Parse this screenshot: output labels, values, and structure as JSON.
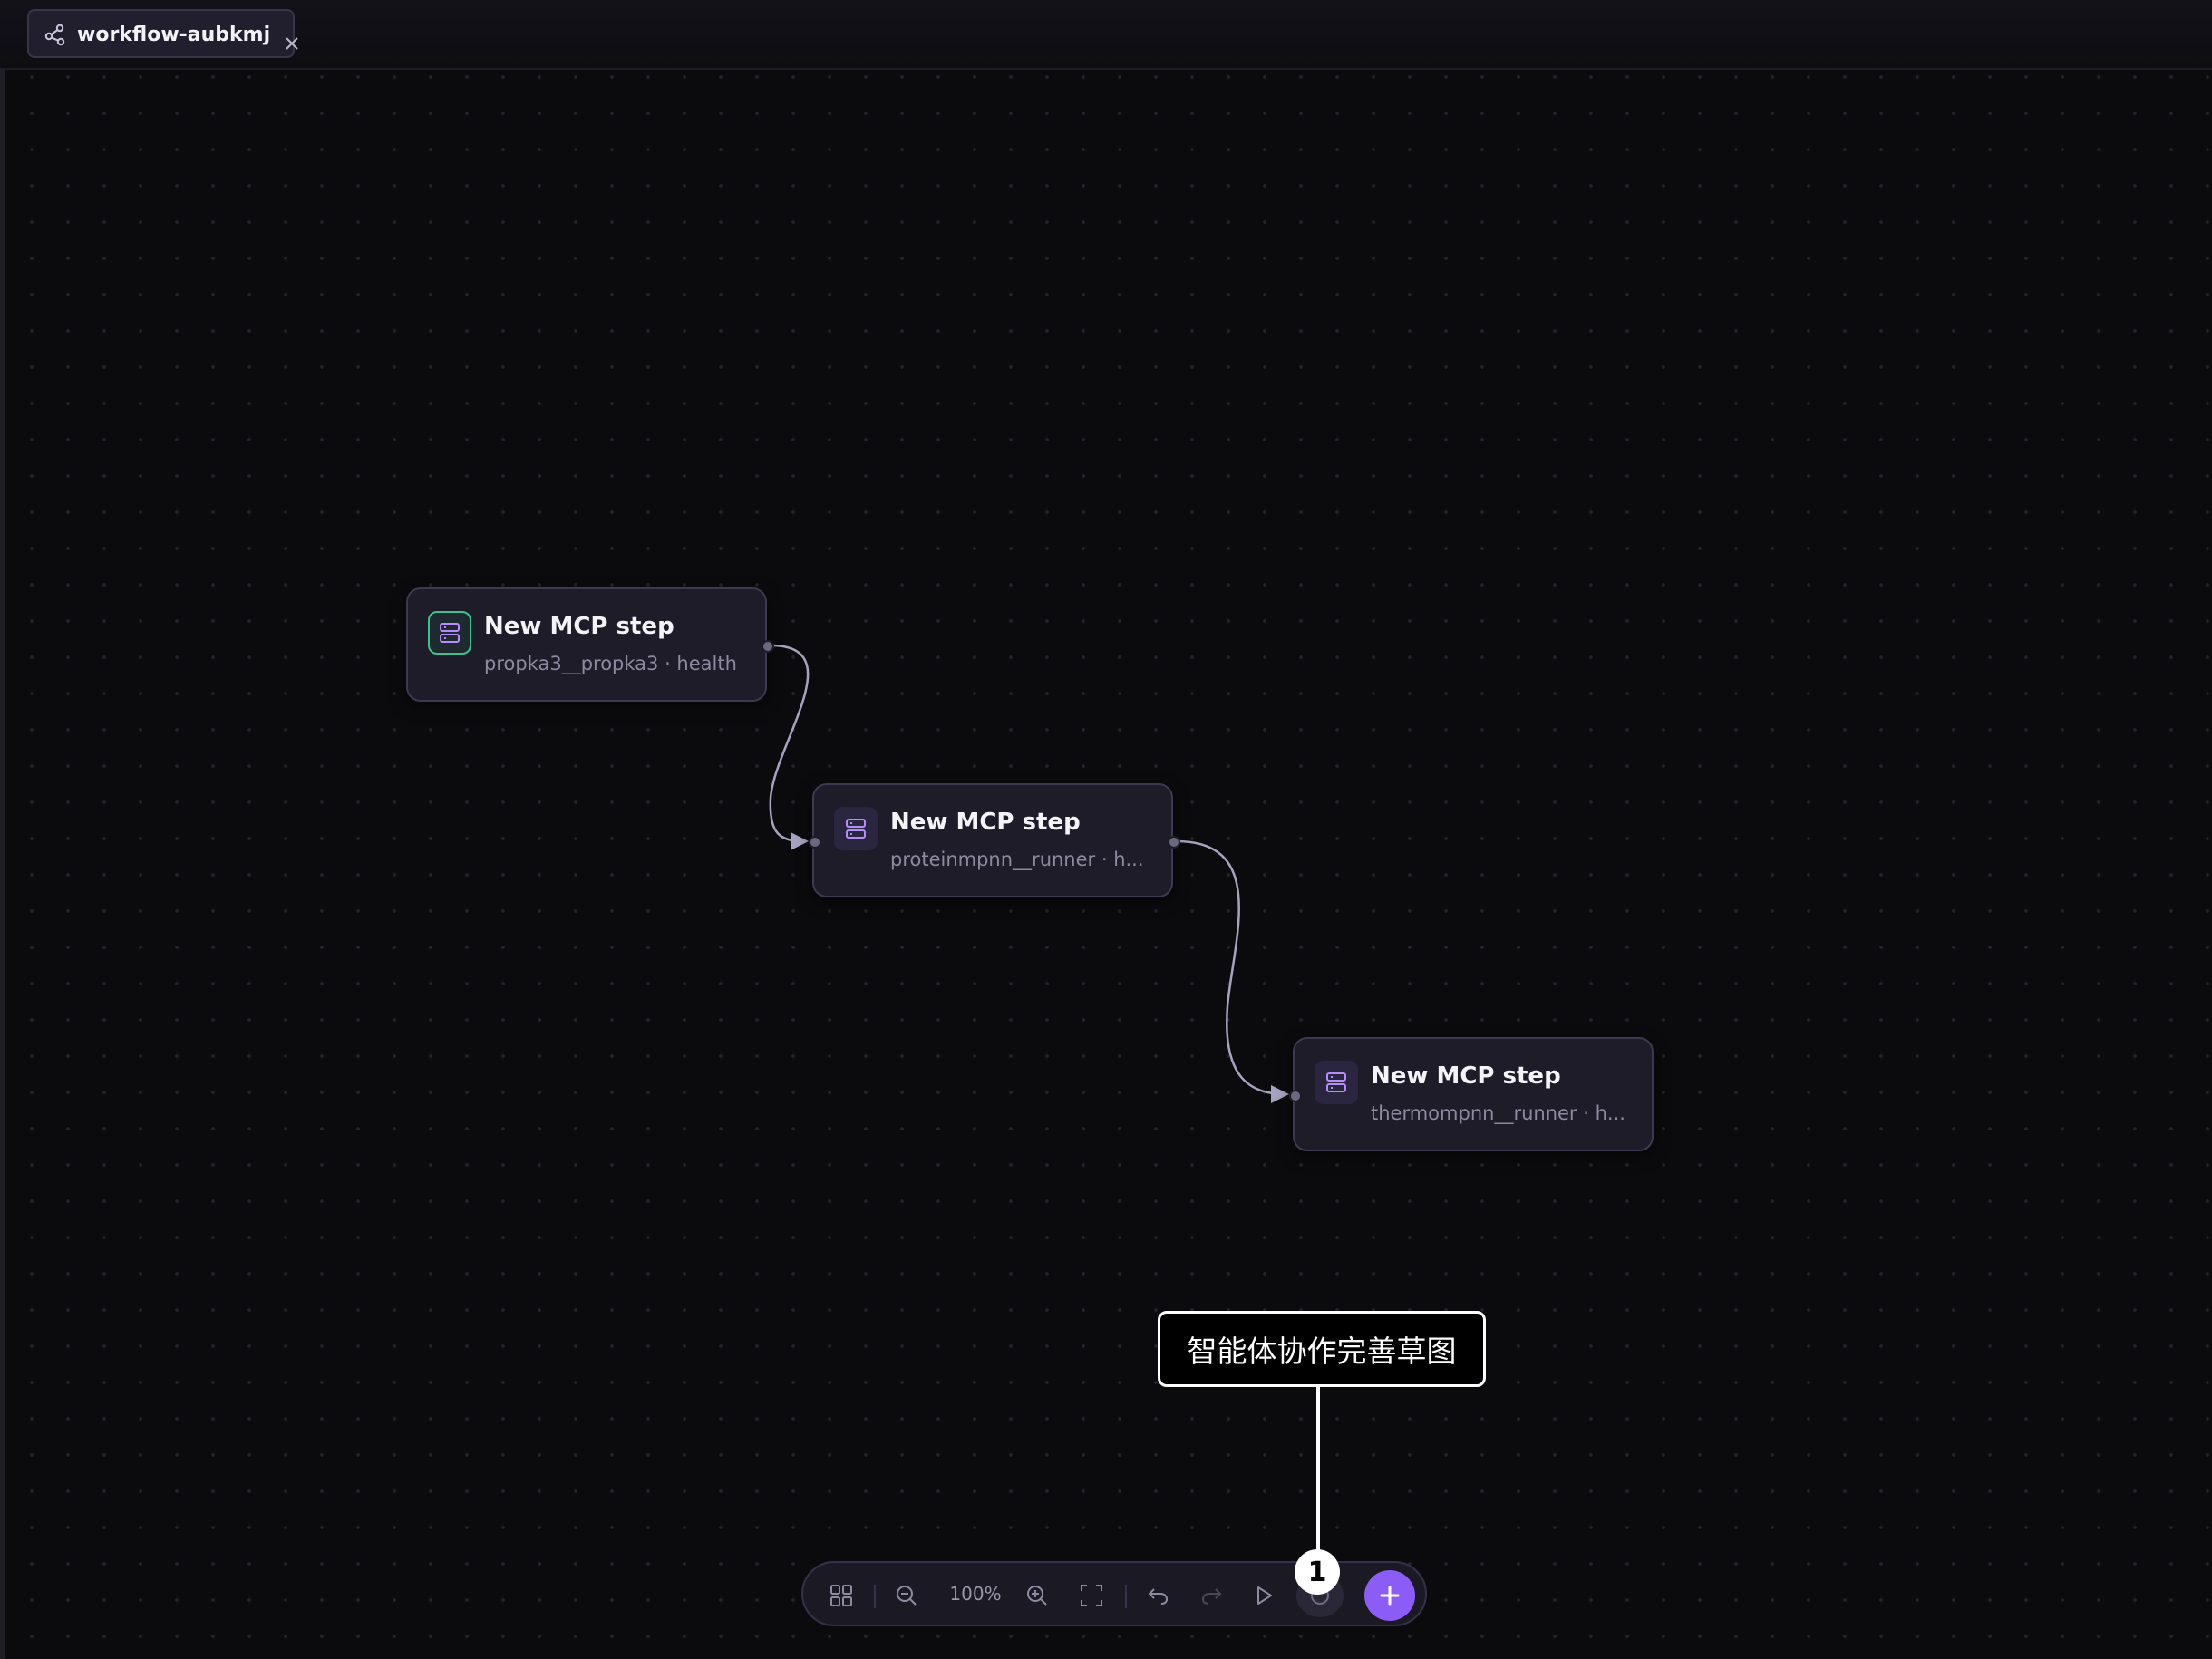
{
  "tab": {
    "icon": "workflow-icon",
    "title": "workflow-aubkmj",
    "close_icon": "close-icon"
  },
  "nodes": [
    {
      "title": "New MCP step",
      "subtitle": "propka3__propka3 · health",
      "icon": "server-icon",
      "selected": true
    },
    {
      "title": "New MCP step",
      "subtitle": "proteinmpnn__runner · h...",
      "icon": "server-icon",
      "selected": false
    },
    {
      "title": "New MCP step",
      "subtitle": "thermompnn__runner · h...",
      "icon": "server-icon",
      "selected": false
    }
  ],
  "toolbar": {
    "zoom_label": "100%",
    "buttons": [
      "grid-icon",
      "zoom-out-icon",
      "zoom-in-icon",
      "fit-view-icon",
      "undo-icon",
      "redo-icon",
      "run-icon",
      "agent-icon",
      "plus-icon"
    ]
  },
  "annotation": {
    "text": "智能体协作完善草图",
    "badge": "1"
  },
  "colors": {
    "accent": "#8b5cf6",
    "selected_border": "#3fbf8f",
    "edge": "#a6a3c2",
    "node_bg": "#1e1c28"
  }
}
